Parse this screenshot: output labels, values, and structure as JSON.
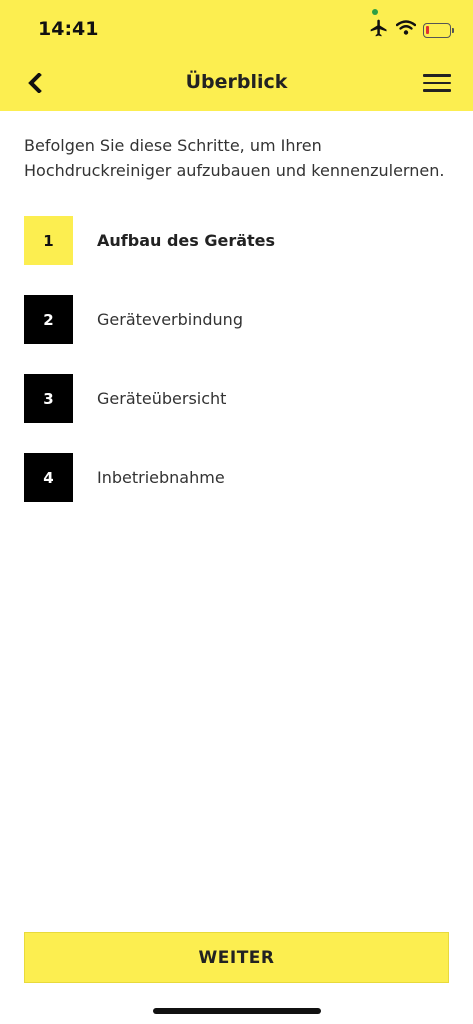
{
  "status_bar": {
    "time": "14:41",
    "icons": [
      "airplane-icon",
      "wifi-icon",
      "battery-low-icon"
    ],
    "colors": {
      "battery_low": "#e03131",
      "location_dot": "#2f9e44"
    }
  },
  "nav": {
    "title": "Überblick",
    "back_icon": "chevron-left-icon",
    "menu_icon": "hamburger-menu-icon"
  },
  "intro_text": "Befolgen Sie diese Schritte, um Ihren Hochdruckreiniger aufzubauen und kennenzulernen.",
  "steps": [
    {
      "number": "1",
      "label": "Aufbau des Gerätes",
      "active": true
    },
    {
      "number": "2",
      "label": "Geräteverbindung",
      "active": false
    },
    {
      "number": "3",
      "label": "Geräteübersicht",
      "active": false
    },
    {
      "number": "4",
      "label": "Inbetriebnahme",
      "active": false
    }
  ],
  "footer": {
    "button_label": "WEITER"
  },
  "colors": {
    "brand_yellow": "#fcee50",
    "step_inactive": "#000000",
    "text": "#222222"
  }
}
